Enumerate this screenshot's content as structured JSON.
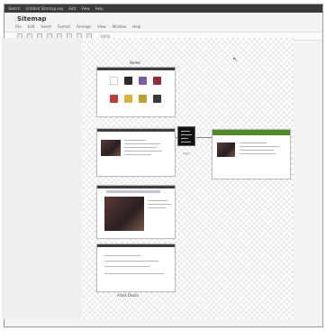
{
  "os_bar": {
    "items": [
      "Sketch",
      "Untitled Sitemap.key",
      "Edit",
      "View",
      "Help"
    ]
  },
  "document": {
    "title": "Sitemap"
  },
  "menubar": {
    "items": [
      "File",
      "Edit",
      "Insert",
      "Format",
      "Arrange",
      "View",
      "Window",
      "Help"
    ]
  },
  "toolbar": {
    "zoom_label": "100%"
  },
  "flow": {
    "title": "Home",
    "login_label": "Login",
    "footer_label": "Artist Detail"
  },
  "colors": {
    "tile_colors": [
      "#2b2b2b",
      "#7b5ea7",
      "#d8b23a",
      "#8c2f3a",
      "#c13a3a",
      "#d87a2f",
      "#b8a238",
      "#3a3a3a"
    ],
    "accent_green": "#4f8a2a",
    "os_bar": "#3a3a3a"
  }
}
